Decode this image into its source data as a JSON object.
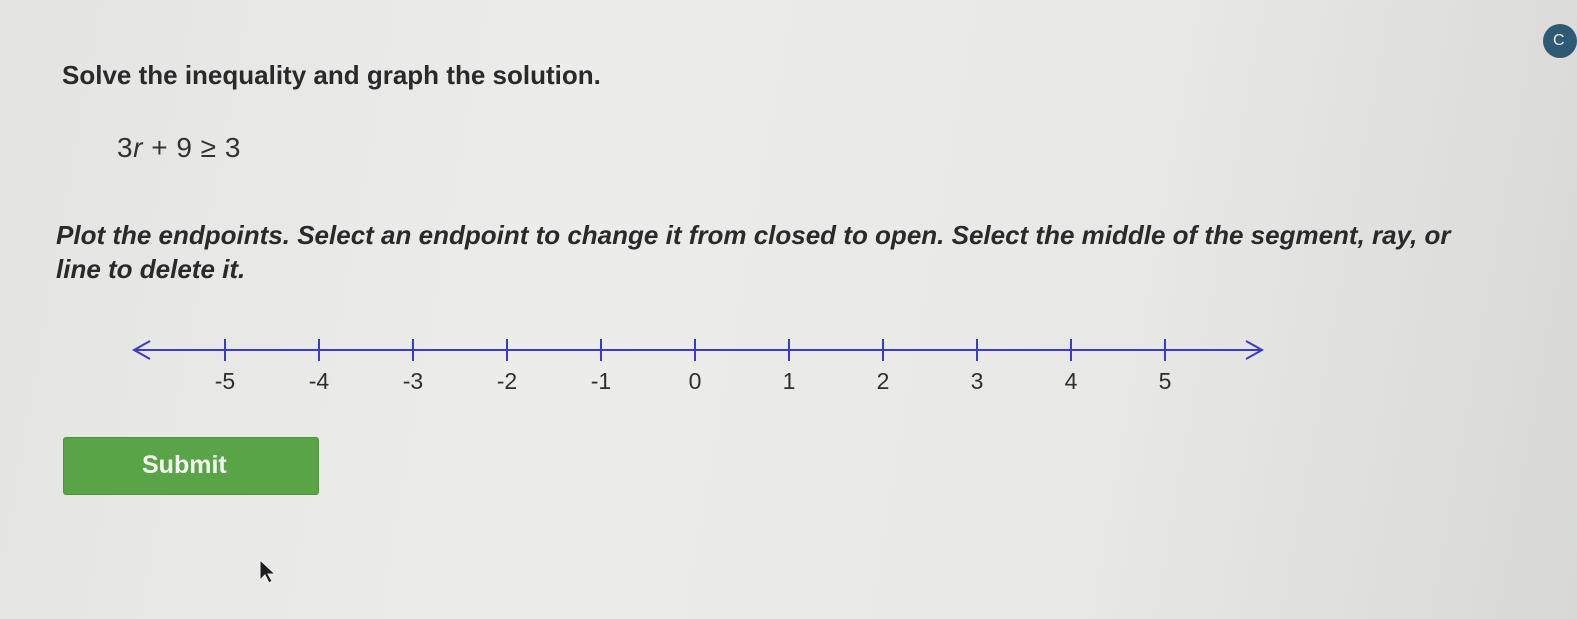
{
  "problem": {
    "prompt": "Solve the inequality and graph the solution.",
    "equation": {
      "coefficient": "3",
      "variable": "r",
      "rest": "+ 9 ≥ 3"
    },
    "instructions": "Plot the endpoints. Select an endpoint to change it from closed to open. Select the middle of the segment, ray, or line to delete it."
  },
  "number_line": {
    "min": -5,
    "max": 5,
    "tick_labels": [
      "-5",
      "-4",
      "-3",
      "-2",
      "-1",
      "0",
      "1",
      "2",
      "3",
      "4",
      "5"
    ],
    "line_color": "#3a3ad0"
  },
  "actions": {
    "submit_label": "Submit",
    "submit_color": "#5aa448"
  },
  "icons": {
    "corner": "partial-circle-badge-icon",
    "pointer": "mouse-pointer-icon"
  }
}
